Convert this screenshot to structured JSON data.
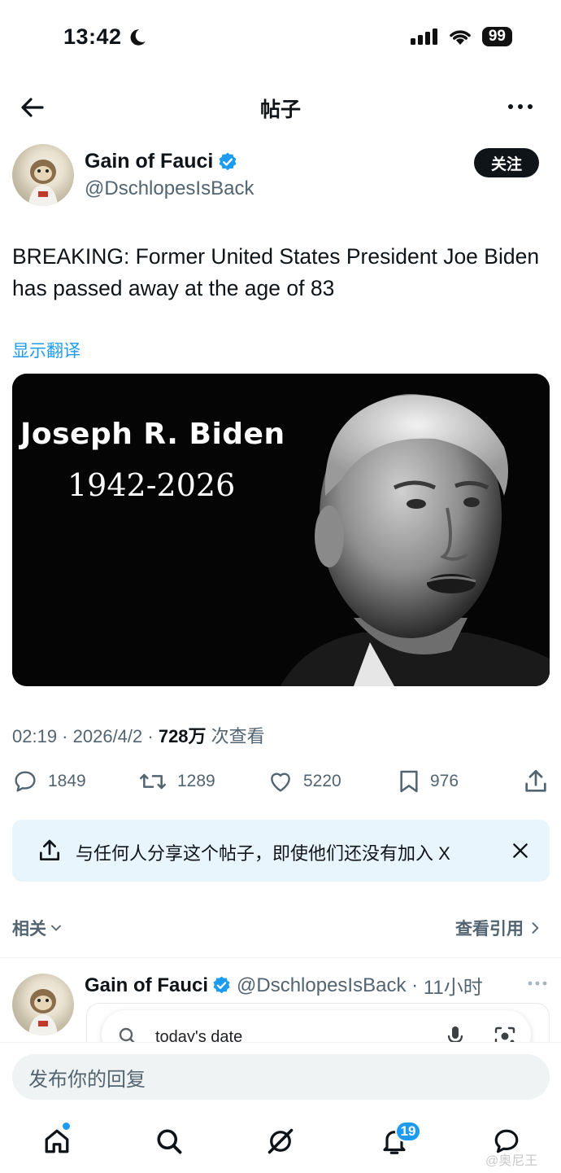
{
  "status_bar": {
    "time": "13:42",
    "battery": "99"
  },
  "header": {
    "title": "帖子"
  },
  "author": {
    "name": "Gain of Fauci",
    "handle": "@DschlopesIsBack",
    "follow_label": "关注"
  },
  "post": {
    "text": "BREAKING: Former United States President Joe Biden has passed away at the age of 83",
    "translate_label": "显示翻译",
    "image": {
      "name_text": "Joseph R. Biden",
      "years_text": "1942-2026"
    },
    "meta_time": "02:19",
    "meta_date": "2026/4/2",
    "meta_views": "728万",
    "meta_views_label": "次查看"
  },
  "actions": {
    "replies": "1849",
    "retweets": "1289",
    "likes": "5220",
    "bookmarks": "976"
  },
  "share_banner": {
    "text": "与任何人分享这个帖子，即使他们还没有加入 X"
  },
  "related": {
    "label": "相关",
    "quotes_link": "查看引用",
    "post": {
      "name": "Gain of Fauci",
      "handle": "@DschlopesIsBack",
      "time": "11小时",
      "search_text": "today's date"
    }
  },
  "reply": {
    "placeholder": "发布你的回复"
  },
  "tab_bar": {
    "notification_count": "19"
  },
  "watermark": "@奥尼王",
  "colors": {
    "accent": "#1d9bf0",
    "text": "#0f1419",
    "secondary": "#536471",
    "banner_bg": "#e8f5fd"
  }
}
